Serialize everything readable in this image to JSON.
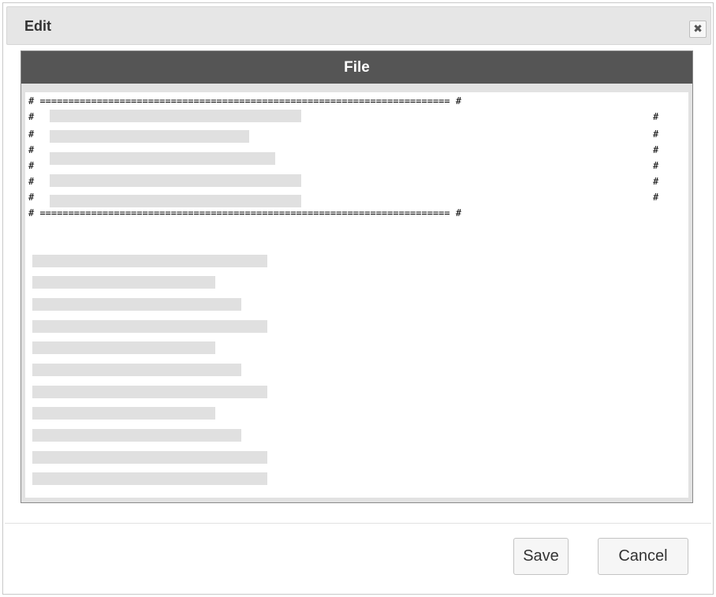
{
  "dialog": {
    "title": "Edit",
    "close_icon": "close-icon",
    "close_glyph": "✖"
  },
  "panel": {
    "header": "File",
    "border_line": "# ======================================================================== #",
    "hash": "#"
  },
  "footer": {
    "save_label": "Save",
    "cancel_label": "Cancel"
  }
}
